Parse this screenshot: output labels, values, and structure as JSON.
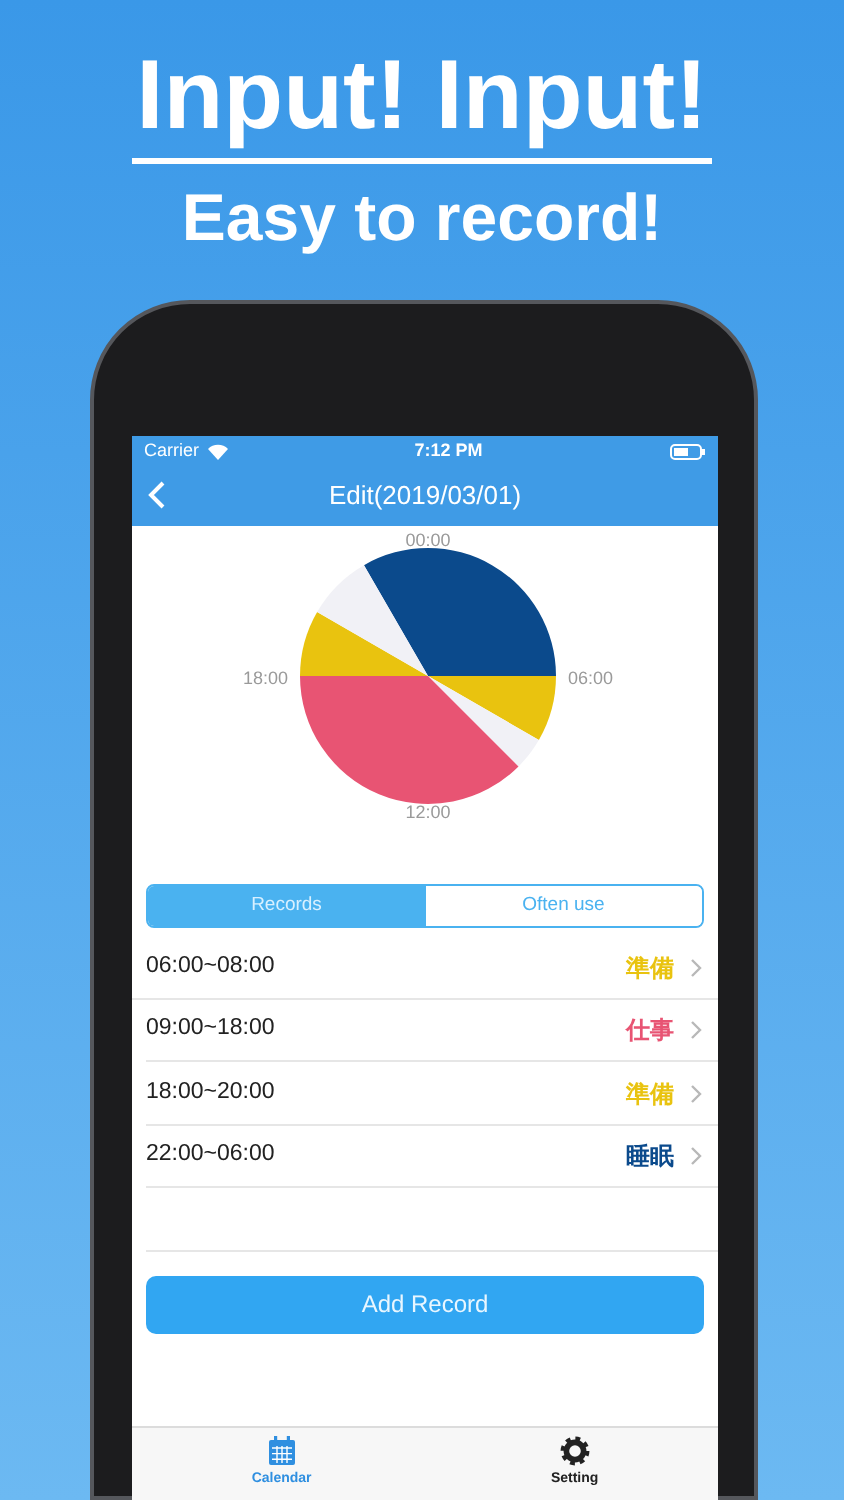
{
  "headline": {
    "title": "Input! Input!",
    "subtitle": "Easy to record!"
  },
  "status_bar": {
    "carrier": "Carrier",
    "time": "7:12 PM"
  },
  "nav": {
    "title": "Edit(2019/03/01)"
  },
  "clock_labels": [
    "00:00",
    "06:00",
    "12:00",
    "18:00"
  ],
  "segments": [
    {
      "label": "Records",
      "selected": true
    },
    {
      "label": "Often use",
      "selected": false
    }
  ],
  "records": [
    {
      "time": "06:00~08:00",
      "category": "準備",
      "color": "#e9c30f"
    },
    {
      "time": "09:00~18:00",
      "category": "仕事",
      "color": "#e85473"
    },
    {
      "time": "18:00~20:00",
      "category": "準備",
      "color": "#e9c30f"
    },
    {
      "time": "22:00~06:00",
      "category": "睡眠",
      "color": "#0b4a8c"
    }
  ],
  "add_button": "Add Record",
  "tab_bar": [
    {
      "label": "Calendar",
      "selected": true,
      "kind": "calendar"
    },
    {
      "label": "Setting",
      "selected": false,
      "kind": "gear"
    }
  ]
}
